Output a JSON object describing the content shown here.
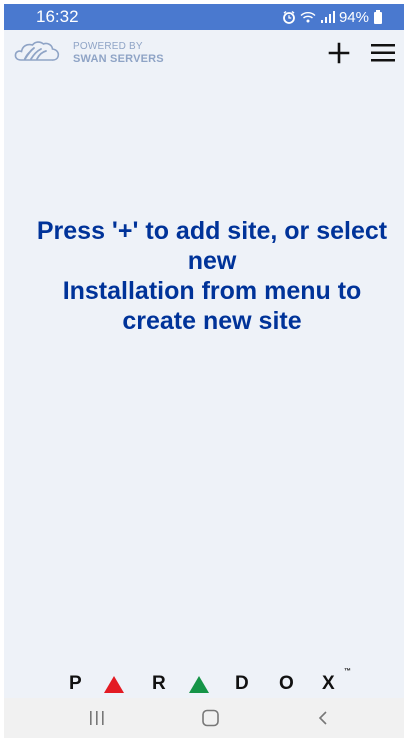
{
  "status_bar": {
    "time": "16:32",
    "battery": "94%",
    "icons": [
      "alarm-icon",
      "wifi-icon",
      "signal-icon",
      "battery-icon"
    ]
  },
  "header": {
    "powered_by": "POWERED BY",
    "company": "SWAN SERVERS",
    "add_icon": "plus-icon",
    "menu_icon": "hamburger-menu-icon"
  },
  "main": {
    "message_line_1": "Press '+' to add site, or select",
    "message_line_2": "new",
    "message_line_3": "Installation from menu to",
    "message_line_4": "create new site"
  },
  "brand": {
    "letters": [
      "P",
      "R",
      "D",
      "O",
      "X"
    ],
    "trademark": "™",
    "colors": {
      "red": "#e31b23",
      "green": "#159447",
      "text": "#111111"
    }
  },
  "navigation_bar": {
    "buttons": [
      "recent-apps-icon",
      "home-icon",
      "back-icon"
    ]
  },
  "colors": {
    "status_bar": "#4a79cf",
    "background": "#eef2f8",
    "message": "#003399",
    "logo": "#8fa4c6",
    "nav_bar": "#f1f1f1"
  }
}
